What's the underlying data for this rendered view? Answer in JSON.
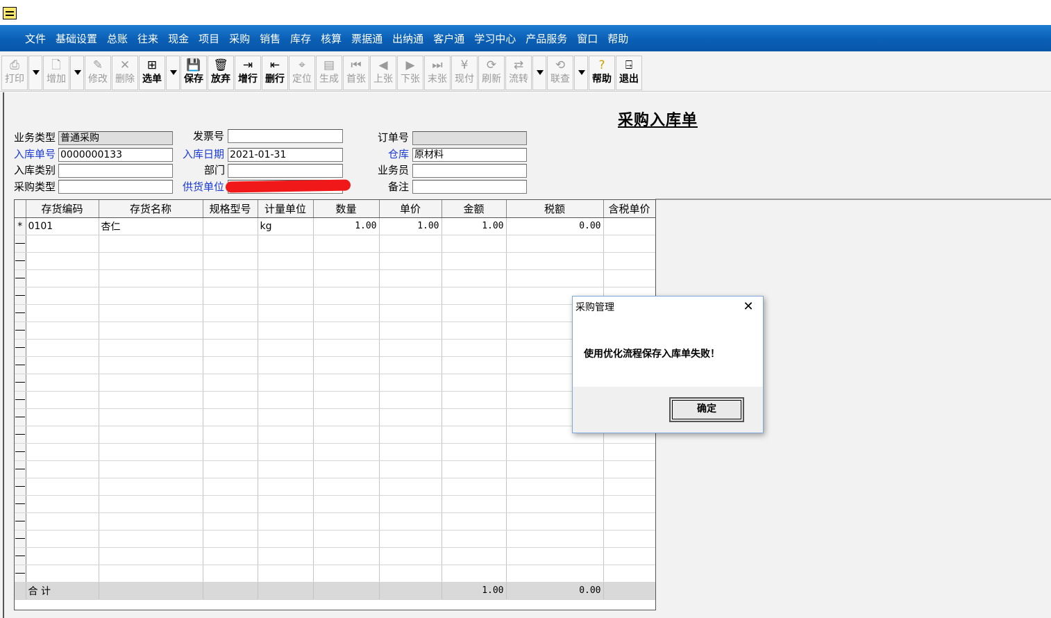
{
  "menu": [
    "文件",
    "基础设置",
    "总账",
    "往来",
    "现金",
    "项目",
    "采购",
    "销售",
    "库存",
    "核算",
    "票据通",
    "出纳通",
    "客户通",
    "学习中心",
    "产品服务",
    "窗口",
    "帮助"
  ],
  "toolbar": {
    "print": "打印",
    "add": "增加",
    "edit": "修改",
    "delete": "删除",
    "select": "选单",
    "save": "保存",
    "discard": "放弃",
    "add_row": "增行",
    "delete_row": "删行",
    "locate": "定位",
    "generate": "生成",
    "first": "首张",
    "prev": "上张",
    "next": "下张",
    "last": "末张",
    "pay_now": "现付",
    "refresh": "刷新",
    "flow": "流转",
    "link_query": "联查",
    "help": "帮助",
    "exit": "退出"
  },
  "form": {
    "title": "采购入库单",
    "business_type_label": "业务类型",
    "business_type": "普通采购",
    "invoice_no_label": "发票号",
    "invoice_no": "",
    "order_no_label": "订单号",
    "order_no": "",
    "receipt_no_label": "入库单号",
    "receipt_no": "0000000133",
    "receipt_date_label": "入库日期",
    "receipt_date": "2021-01-31",
    "warehouse_label": "仓库",
    "warehouse": "原材料",
    "receipt_category_label": "入库类别",
    "receipt_category": "",
    "department_label": "部门",
    "department": "",
    "salesperson_label": "业务员",
    "salesperson": "",
    "purchase_type_label": "采购类型",
    "purchase_type": "",
    "supplier_label": "供货单位",
    "supplier": "",
    "remark_label": "备注",
    "remark": ""
  },
  "grid": {
    "columns": [
      "存货编码",
      "存货名称",
      "规格型号",
      "计量单位",
      "数量",
      "单价",
      "金额",
      "税额",
      "含税单价"
    ],
    "rows": [
      {
        "marker": "*",
        "code": "0101",
        "name": "杏仁",
        "spec": "",
        "unit": "kg",
        "qty": "1.00",
        "price": "1.00",
        "amount": "1.00",
        "tax": "0.00",
        "tax_price": ""
      }
    ],
    "total_label": "合 计",
    "total_amount": "1.00",
    "total_tax": "0.00"
  },
  "dialog": {
    "title": "采购管理",
    "message": "使用优化流程保存入库单失败！",
    "ok_label": "确定"
  }
}
